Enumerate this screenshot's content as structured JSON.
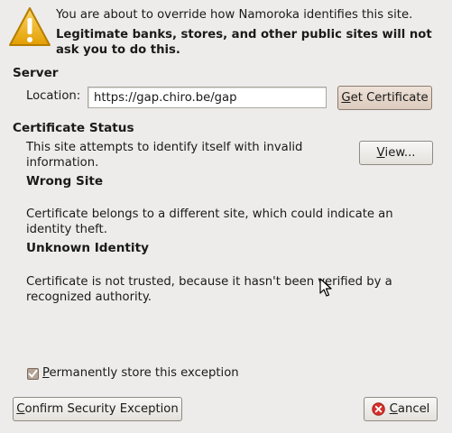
{
  "warning": {
    "icon": "warning-triangle-icon",
    "line1": "You are about to override how Namoroka identifies this site.",
    "line2": "Legitimate banks, stores, and other public sites will not ask you to do this."
  },
  "server": {
    "heading": "Server",
    "location_label": "Location:",
    "location_value": "https://gap.chiro.be/gap",
    "get_certificate": {
      "accel": "G",
      "rest": "et Certificate"
    }
  },
  "certificate_status": {
    "heading": "Certificate Status",
    "summary": "This site attempts to identify itself with invalid information.",
    "view_button": {
      "accel": "V",
      "rest": "iew..."
    },
    "wrong_site": {
      "title": "Wrong Site",
      "text": "Certificate belongs to a different site, which could indicate an identity theft."
    },
    "unknown_identity": {
      "title": "Unknown Identity",
      "text": "Certificate is not trusted, because it hasn't been verified by a recognized authority."
    }
  },
  "store_exception": {
    "checked": true,
    "accel": "P",
    "rest": "ermanently store this exception"
  },
  "buttons": {
    "confirm": {
      "accel": "C",
      "rest": "onfirm Security Exception"
    },
    "cancel": {
      "accel": "C",
      "rest": "ancel",
      "icon": "cancel-circle-icon"
    }
  },
  "colors": {
    "background": "#edeceb",
    "warning_yellow": "#f0b400",
    "cancel_red": "#d9312b"
  }
}
